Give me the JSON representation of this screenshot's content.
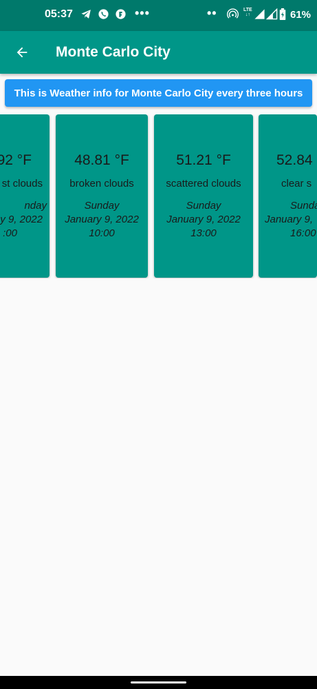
{
  "status_bar": {
    "time": "05:37",
    "battery": "61%",
    "network": "LTE",
    "icons": [
      "telegram-icon",
      "whatsapp-icon",
      "app-icon",
      "more-dots-icon",
      "dots-icon",
      "hotspot-icon",
      "signal-icon",
      "signal-icon-2",
      "battery-icon"
    ]
  },
  "app_bar": {
    "title": "Monte Carlo City",
    "back_icon": "arrow-back-icon"
  },
  "info_button": {
    "label": "This is Weather info for Monte Carlo City every three hours"
  },
  "cards": [
    {
      "temp": "92 °F",
      "desc": "st clouds",
      "day": "nday",
      "date": "y 9, 2022",
      "time": ":00"
    },
    {
      "temp": "48.81 °F",
      "desc": "broken clouds",
      "day": "Sunday",
      "date": "January 9, 2022",
      "time": "10:00"
    },
    {
      "temp": "51.21 °F",
      "desc": "scattered clouds",
      "day": "Sunday",
      "date": "January 9, 2022",
      "time": "13:00"
    },
    {
      "temp": "52.84",
      "desc": "clear s",
      "day": "Sunda",
      "date": "January 9, ",
      "time": "16:00"
    }
  ],
  "colors": {
    "status_bar": "#00796b",
    "app_bar": "#009688",
    "card": "#009688",
    "button": "#2196f3",
    "background": "#fafafa"
  }
}
